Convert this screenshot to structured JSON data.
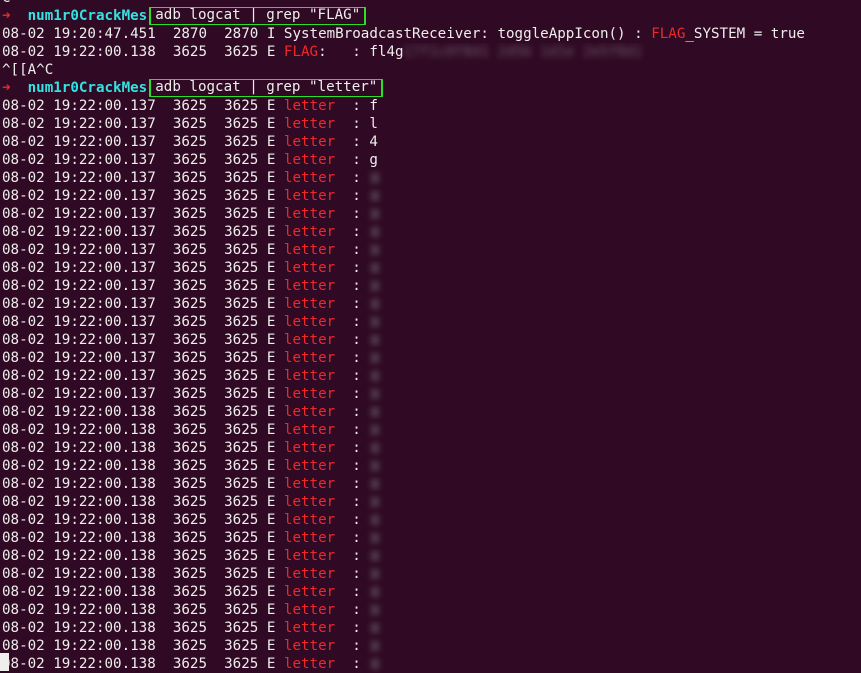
{
  "prompt": {
    "arrow": "➜",
    "dir": "num1r0CrackMes"
  },
  "top_partial": "C",
  "commands": {
    "first": "adb logcat | grep \"FLAG\"",
    "second": "adb logcat | grep \"letter\""
  },
  "flag_lines": [
    {
      "time": "08-02 19:20:47.451",
      "pid": "2870",
      "tid": "2870",
      "level": "I",
      "pre": "SystemBroadcastReceiver: toggleAppIcon() : ",
      "tag": "FLAG",
      "post": "_SYSTEM = true"
    },
    {
      "time": "08-02 19:22:00.138",
      "pid": "3625",
      "tid": "3625",
      "level": "E",
      "tag": "FLAG",
      "sep": ":   :",
      "value": "fl4g"
    }
  ],
  "interrupt": "^[[A^C",
  "letter_tag": "letter",
  "letter_sep": ":",
  "letter_lines": [
    {
      "time": "08-02 19:22:00.137",
      "value": "f"
    },
    {
      "time": "08-02 19:22:00.137",
      "value": "l"
    },
    {
      "time": "08-02 19:22:00.137",
      "value": "4"
    },
    {
      "time": "08-02 19:22:00.137",
      "value": "g"
    },
    {
      "time": "08-02 19:22:00.137"
    },
    {
      "time": "08-02 19:22:00.137"
    },
    {
      "time": "08-02 19:22:00.137"
    },
    {
      "time": "08-02 19:22:00.137"
    },
    {
      "time": "08-02 19:22:00.137"
    },
    {
      "time": "08-02 19:22:00.137"
    },
    {
      "time": "08-02 19:22:00.137"
    },
    {
      "time": "08-02 19:22:00.137"
    },
    {
      "time": "08-02 19:22:00.137"
    },
    {
      "time": "08-02 19:22:00.137"
    },
    {
      "time": "08-02 19:22:00.137"
    },
    {
      "time": "08-02 19:22:00.137"
    },
    {
      "time": "08-02 19:22:00.137"
    },
    {
      "time": "08-02 19:22:00.138"
    },
    {
      "time": "08-02 19:22:00.138"
    },
    {
      "time": "08-02 19:22:00.138"
    },
    {
      "time": "08-02 19:22:00.138"
    },
    {
      "time": "08-02 19:22:00.138"
    },
    {
      "time": "08-02 19:22:00.138"
    },
    {
      "time": "08-02 19:22:00.138"
    },
    {
      "time": "08-02 19:22:00.138"
    },
    {
      "time": "08-02 19:22:00.138"
    },
    {
      "time": "08-02 19:22:00.138"
    },
    {
      "time": "08-02 19:22:00.138"
    },
    {
      "time": "08-02 19:22:00.138"
    },
    {
      "time": "08-02 19:22:00.138"
    },
    {
      "time": "08-02 19:22:00.138"
    },
    {
      "time": "08-02 19:22:00.138"
    }
  ],
  "letter_pid": "3625",
  "letter_tid": "3625",
  "letter_level": "E",
  "colors": {
    "background": "#300a24",
    "text": "#eeeeec",
    "error_tag": "#ef2929",
    "prompt_dir": "#34e2e2",
    "highlight_box": "#27e027"
  }
}
